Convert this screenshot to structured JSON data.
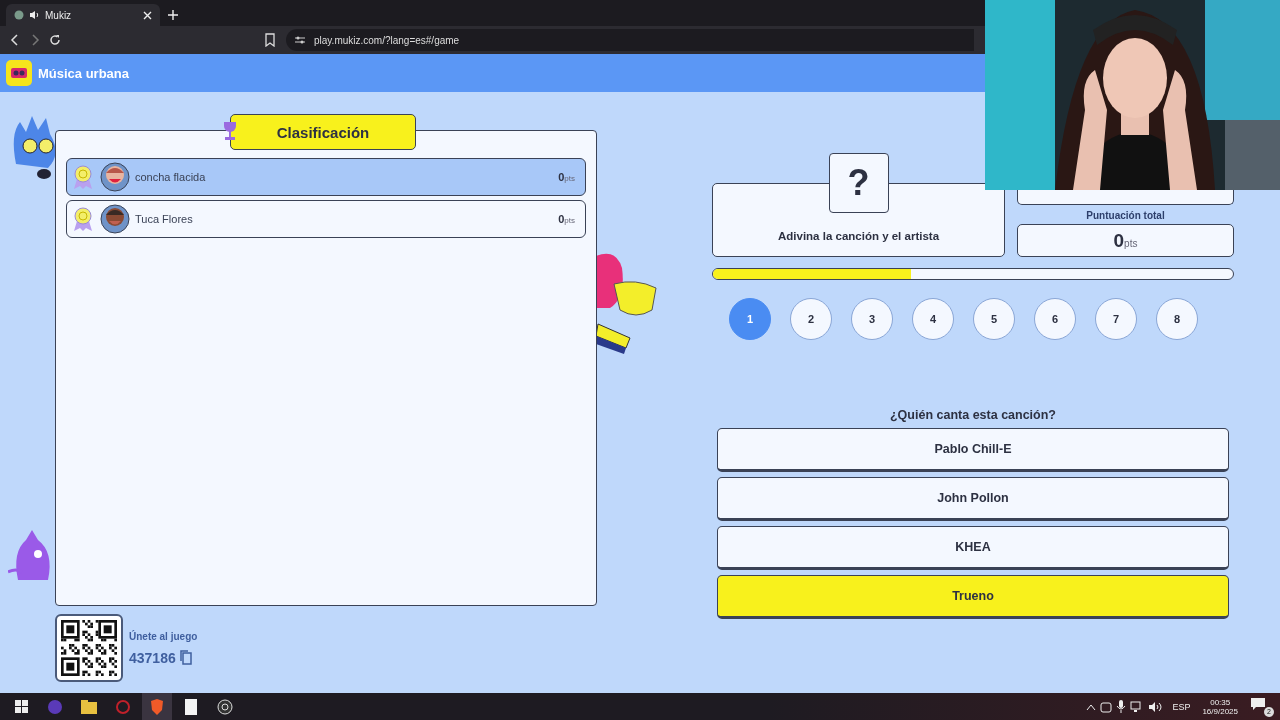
{
  "browser": {
    "tab_title": "Mukiz",
    "address": "play.mukiz.com/?lang=es#/game"
  },
  "header": {
    "title": "Música urbana"
  },
  "leaderboard": {
    "title": "Clasificación",
    "players": [
      {
        "name": "concha flacida",
        "score": "0",
        "unit": "pts",
        "selected": true
      },
      {
        "name": "Tuca Flores",
        "score": "0",
        "unit": "pts",
        "selected": false
      }
    ]
  },
  "join": {
    "label": "Únete al juego",
    "code": "437186"
  },
  "round_card": {
    "symbol": "?",
    "text": "Adivina la canción y el artista"
  },
  "score": {
    "label": "Puntuación total",
    "value": "0",
    "unit": "pts"
  },
  "progress": {
    "level": 0.38
  },
  "rounds": [
    {
      "label": "1",
      "selected": true
    },
    {
      "label": "2",
      "selected": false
    },
    {
      "label": "3",
      "selected": false
    },
    {
      "label": "4",
      "selected": false
    },
    {
      "label": "5",
      "selected": false
    },
    {
      "label": "6",
      "selected": false
    },
    {
      "label": "7",
      "selected": false
    },
    {
      "label": "8",
      "selected": false
    }
  ],
  "question": {
    "text": "¿Quién canta esta canción?",
    "answers": [
      {
        "label": "Pablo Chill-E",
        "selected": false
      },
      {
        "label": "John Pollon",
        "selected": false
      },
      {
        "label": "KHEA",
        "selected": false
      },
      {
        "label": "Trueno",
        "selected": true
      }
    ]
  },
  "taskbar": {
    "language": "ESP",
    "time": "00:35",
    "date": "16/9/2025",
    "notifications": "2"
  }
}
